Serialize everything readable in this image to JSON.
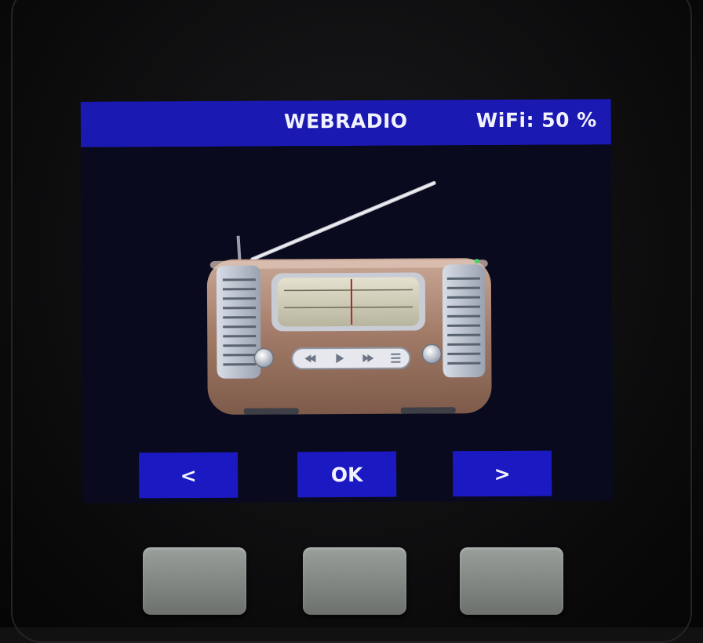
{
  "header": {
    "title": "WEBRADIO",
    "wifi": "WiFi: 50 %"
  },
  "navigation": {
    "prev_label": "<",
    "ok_label": "OK",
    "next_label": ">"
  },
  "station_image": {
    "icon": "vintage-radio-illustration"
  },
  "colors": {
    "header_bg": "#1a19b2",
    "button_bg": "#1a19c2",
    "screen_bg": "#0a0a1f",
    "radio_body": "#a07a66",
    "hardware_button": "#8a8f8c"
  }
}
